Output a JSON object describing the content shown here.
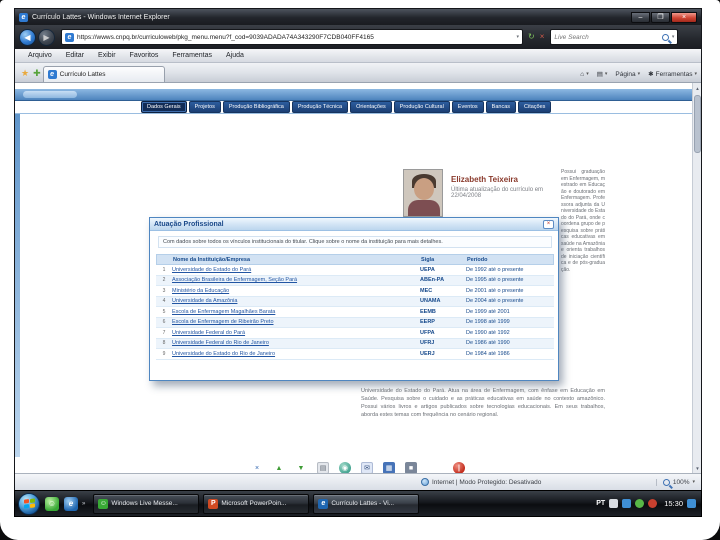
{
  "window": {
    "title": "Currículo Lattes - Windows Internet Explorer"
  },
  "icons": {
    "ie_e": "e",
    "minimize": "–",
    "maximize": "❐",
    "close": "×",
    "back": "◀",
    "forward": "▶",
    "addr_caret": "▾",
    "refresh": "↻",
    "stop": "×",
    "star": "★",
    "star_add": "✚",
    "home": "⌂",
    "print": "▤",
    "caret": "▾",
    "gear": "✱",
    "scroll_up": "▲",
    "scroll_down": "▼",
    "msn": "☺",
    "ppt": "P",
    "quick_chevron": "»",
    "dialog_close": "×"
  },
  "address_bar": {
    "url": "https://wwws.cnpq.br/curriculoweb/pkg_menu.menu?f_cod=9039ADADA74A343290F7CDB040FF4165",
    "search_placeholder": "Live Search"
  },
  "menu_bar": {
    "items": [
      "Arquivo",
      "Editar",
      "Exibir",
      "Favoritos",
      "Ferramentas",
      "Ajuda"
    ]
  },
  "tab_bar": {
    "tab_title": "Currículo Lattes",
    "page_menu": "Página",
    "tools_menu": "Ferramentas"
  },
  "lattes": {
    "nav_tabs": [
      "Dados Gerais",
      "Projetos",
      "Produção Bibliográfica",
      "Produção Técnica",
      "Orientações",
      "Produção Cultural",
      "Eventos",
      "Bancas",
      "Citações"
    ],
    "profile": {
      "name": "Elizabeth Teixeira",
      "updated": "Última atualização do currículo em 22/04/2008"
    },
    "dialog": {
      "title": "Atuação Profissional",
      "intro": "Com dados sobre todos os vínculos institucionais do titular. Clique sobre o nome da instituição para mais detalhes.",
      "table": {
        "headers": [
          "Nome da Instituição/Empresa",
          "Sigla",
          "Período"
        ],
        "rows": [
          {
            "num": "1",
            "name": "Universidade do Estado do Pará",
            "sigla": "UEPA",
            "periodo": "De 1992 até o presente"
          },
          {
            "num": "2",
            "name": "Associação Brasileira de Enfermagem, Seção Pará",
            "sigla": "ABEn-PA",
            "periodo": "De 1995 até o presente"
          },
          {
            "num": "3",
            "name": "Ministério da Educação",
            "sigla": "MEC",
            "periodo": "De 2001 até o presente"
          },
          {
            "num": "4",
            "name": "Universidade da Amazônia",
            "sigla": "UNAMA",
            "periodo": "De 2004 até o presente"
          },
          {
            "num": "5",
            "name": "Escola de Enfermagem Magalhães Barata",
            "sigla": "EEMB",
            "periodo": "De 1999 até 2001"
          },
          {
            "num": "6",
            "name": "Escola de Enfermagem de Ribeirão Preto",
            "sigla": "EERP",
            "periodo": "De 1998 até 1999"
          },
          {
            "num": "7",
            "name": "Universidade Federal do Pará",
            "sigla": "UFPA",
            "periodo": "De 1990 até 1992"
          },
          {
            "num": "8",
            "name": "Universidade Federal do Rio de Janeiro",
            "sigla": "UFRJ",
            "periodo": "De 1986 até 1990"
          },
          {
            "num": "9",
            "name": "Universidade do Estado do Rio de Janeiro",
            "sigla": "UERJ",
            "periodo": "De 1984 até 1986"
          }
        ]
      }
    },
    "summary": "Universidade do Estado do Pará. Atua na área de Enfermagem, com ênfase em Educação em Saúde. Pesquisa sobre o cuidado e as práticas educativas em saúde no contexto amazônico. Possui vários livros e artigos publicados sobre tecnologias educacionais. Em seus trabalhos, aborda estes temas com frequência no cenário regional.",
    "side_text": "Possui graduação em Enfermagem, mestrado em Educação e doutorado em Enfermagem. Professora adjunta da Universidade do Estado do Pará, onde coordena grupo de pesquisa sobre práticas educativas em saúde na Amazônia e orienta trabalhos de iniciação científica e de pós-graduação.",
    "footer_icons": [
      {
        "name": "close-icon",
        "glyph": "×"
      },
      {
        "name": "scroll-top-icon",
        "glyph": "▲"
      },
      {
        "name": "scroll-bottom-icon",
        "glyph": "▼"
      },
      {
        "name": "print-icon",
        "glyph": "▤"
      },
      {
        "name": "globe-icon",
        "glyph": "◉"
      },
      {
        "name": "email-icon",
        "glyph": "✉"
      },
      {
        "name": "save-icon",
        "glyph": "▦"
      },
      {
        "name": "help-icon",
        "glyph": "■"
      },
      {
        "name": "power-icon",
        "glyph": "|"
      }
    ]
  },
  "status_bar": {
    "zone": "Internet | Modo Protegido: Desativado",
    "zoom": "100%"
  },
  "taskbar": {
    "buttons": [
      {
        "label": "Windows Live Messe..."
      },
      {
        "label": "Microsoft PowerPoin..."
      },
      {
        "label": "Currículo Lattes - Vi..."
      }
    ],
    "tray": {
      "lang": "PT",
      "clock": "15:30"
    }
  }
}
